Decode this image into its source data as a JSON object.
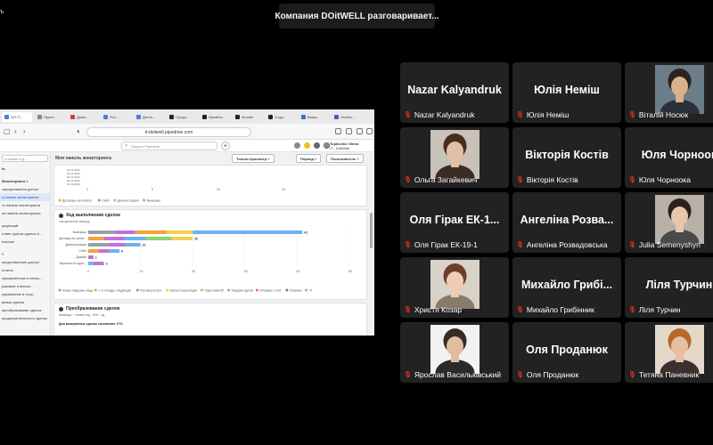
{
  "app_label": "ъ",
  "banner": "Компания DOitWELL разговаривает...",
  "browser": {
    "tabs": [
      {
        "label": "DO IT...",
        "color": "#4a7fd1"
      },
      {
        "label": "Принт...",
        "color": "#888888"
      },
      {
        "label": "Діяль...",
        "color": "#d33b3b"
      },
      {
        "label": "Рос...",
        "color": "#4a7fd1"
      },
      {
        "label": "Дости...",
        "color": "#4a7fd1"
      },
      {
        "label": "Продо...",
        "color": "#222222"
      },
      {
        "label": "Иркайты",
        "color": "#222222"
      },
      {
        "label": "Moodle",
        "color": "#222222"
      },
      {
        "label": "Угоди",
        "color": "#222222"
      },
      {
        "label": "Ваша...",
        "color": "#3b6fd1"
      },
      {
        "label": "OneNo...",
        "color": "#7b3fc0"
      }
    ],
    "url": "it-doitwell.pipedrive.com"
  },
  "app": {
    "search_placeholder": "Поиск в Pipedrive",
    "plus": "+",
    "user_name": "Tupikovko Olena",
    "user_company": "IT - DoItWell"
  },
  "sidebar": {
    "search_placeholder": "е искать в д...",
    "items": [
      {
        "label": "ts",
        "style": "bold"
      },
      {
        "label": "",
        "style": "gap"
      },
      {
        "label": "Мониторинга  ˅",
        "style": "bold"
      },
      {
        "label": "зпредставлени доступ",
        "style": ""
      },
      {
        "label": "я панель мониторинга",
        "style": "active"
      },
      {
        "label": "ть панели мониторинга",
        "style": ""
      },
      {
        "label": "ая панель мониторинга",
        "style": ""
      },
      {
        "label": "",
        "style": "gap"
      },
      {
        "label": "ршующий",
        "style": ""
      },
      {
        "label": "ствие группы сделок А...",
        "style": ""
      },
      {
        "label": "ельные",
        "style": ""
      },
      {
        "label": "",
        "style": "gap"
      },
      {
        "label": "  ˅",
        "style": "bold"
      },
      {
        "label": "представление доступ",
        "style": ""
      },
      {
        "label": "отчеты",
        "style": ""
      },
      {
        "label": "оформленные и нелль...",
        "style": ""
      },
      {
        "label": "разовые и внешн...",
        "style": ""
      },
      {
        "label": "управление и полу...",
        "style": ""
      },
      {
        "label": "ватые сделки",
        "style": ""
      },
      {
        "label": "преобразование сделок",
        "style": ""
      },
      {
        "label": "продолжительность сделок",
        "style": ""
      }
    ]
  },
  "dashboard": {
    "title": "Моя панель мониторинга",
    "chip_view": "Только просмотр  ˅",
    "chip_period": "Период  ˅",
    "chip_user": "Пользователь  ˅",
    "top_legend": [
      "Договоры на оплату",
      "Сейл",
      "Демонстрация",
      "Выигрыш"
    ],
    "top_x_ticks": [
      "0",
      "5",
      "10",
      "15"
    ],
    "top_y_dates": [
      "04.11.2022",
      "04.11.2022",
      "04.11.2022",
      "04.11.2022",
      "04.11.2022"
    ],
    "stage_card": {
      "title": "Ход выполнения сделок",
      "subtitle": "специальный период",
      "legend": [
        "Новые лидерные лиды",
        "1 ст. походы, следующие",
        "Разговор встреч",
        "Бизнес-презентация",
        "Подготовка КП",
        "Продажи сделок",
        "Отправка 1 этап",
        "Отказано",
        "+4"
      ]
    },
    "conversion_card": {
      "title": "Преобразование сделок",
      "subtitle": "Команда ~ только год  ·  Все  ·  сд",
      "line": "Для выигранных сделок составляет 17%"
    }
  },
  "chart_data": {
    "type": "bar",
    "title": "Ход выполнения сделок",
    "orientation": "horizontal",
    "stacked": true,
    "categories": [
      "Выигрыш",
      "Договор на оплат...",
      "Демонстрация",
      "Сейл",
      "Дизайн",
      "Воронка по сдел..."
    ],
    "totals": [
      41,
      20,
      10,
      6,
      1,
      3
    ],
    "x_ticks": [
      "0",
      "10",
      "20",
      "30",
      "40",
      "50"
    ],
    "xlim": [
      0,
      50
    ],
    "segments": [
      [
        {
          "value": 5,
          "color": "#9aa0a8"
        },
        {
          "value": 4,
          "color": "#c471d6"
        },
        {
          "value": 6,
          "color": "#f0a53c"
        },
        {
          "value": 5,
          "color": "#f2cf4c"
        },
        {
          "value": 21,
          "color": "#6fb0f0"
        }
      ],
      [
        {
          "value": 3,
          "color": "#f0a53c"
        },
        {
          "value": 4,
          "color": "#c471d6"
        },
        {
          "value": 4,
          "color": "#6fb0f0"
        },
        {
          "value": 5,
          "color": "#8ed36b"
        },
        {
          "value": 4,
          "color": "#f2cf4c"
        }
      ],
      [
        {
          "value": 4,
          "color": "#9aa0a8"
        },
        {
          "value": 3,
          "color": "#c471d6"
        },
        {
          "value": 3,
          "color": "#6fb0f0"
        }
      ],
      [
        {
          "value": 2,
          "color": "#f0a53c"
        },
        {
          "value": 2,
          "color": "#c471d6"
        },
        {
          "value": 2,
          "color": "#6fb0f0"
        }
      ],
      [
        {
          "value": 1,
          "color": "#c471d6"
        }
      ],
      [
        {
          "value": 1,
          "color": "#6fb0f0"
        },
        {
          "value": 2,
          "color": "#c471d6"
        }
      ]
    ]
  },
  "participants": [
    {
      "display": "Nazar Kalyandruk",
      "label": "Nazar Kalyandruk",
      "photo": false
    },
    {
      "display": "Юлія Неміш",
      "label": "Юлія Неміш",
      "photo": false
    },
    {
      "display": "",
      "label": "Віталій Носюк",
      "photo": true,
      "bg": "#6a7d88",
      "skin": "#d9b28d",
      "hair": "#2a2420",
      "shirt": "#2b2f38"
    },
    {
      "display": "",
      "label": "Ольга Загайкевич",
      "photo": true,
      "bg": "#c9c2b8",
      "skin": "#e3bfa4",
      "hair": "#4a2c1e",
      "shirt": "#3b2b24"
    },
    {
      "display": "Вікторія Костів",
      "label": "Вікторія Костів",
      "photo": false
    },
    {
      "display": "Юля Чорноок",
      "label": "Юля Чорноока",
      "photo": false
    },
    {
      "display": "Оля Гірак ЕК-1...",
      "label": "Оля Гірак ЕК-19-1",
      "photo": false
    },
    {
      "display": "Ангеліна Розва...",
      "label": "Ангеліна Розвадовська",
      "photo": false
    },
    {
      "display": "",
      "label": "Julia Semenyshyn",
      "photo": true,
      "bg": "#b9b1a8",
      "skin": "#e7c6ac",
      "hair": "#2a201c",
      "shirt": "#4a4a4a"
    },
    {
      "display": "",
      "label": "Христя Козар",
      "photo": true,
      "bg": "#d8d2c8",
      "skin": "#efcdb3",
      "hair": "#6b3f26",
      "shirt": "#8a7a6a"
    },
    {
      "display": "Михайло Грибі...",
      "label": "Михайло Грибінник",
      "photo": false
    },
    {
      "display": "Ліля Турчин",
      "label": "Ліля Турчин",
      "photo": false
    },
    {
      "display": "",
      "label": "Ярослав Васильківський",
      "photo": true,
      "bg": "#f2f2f2",
      "skin": "#e0bd9f",
      "hair": "#3a2a22",
      "shirt": "#2a2a2a"
    },
    {
      "display": "Оля Проданюк",
      "label": "Оля Проданюк",
      "photo": false
    },
    {
      "display": "",
      "label": "Тетяна Паневник",
      "photo": true,
      "bg": "#e4d8c8",
      "skin": "#e6c0a0",
      "hair": "#b36a2c",
      "shirt": "#3a3030"
    }
  ]
}
